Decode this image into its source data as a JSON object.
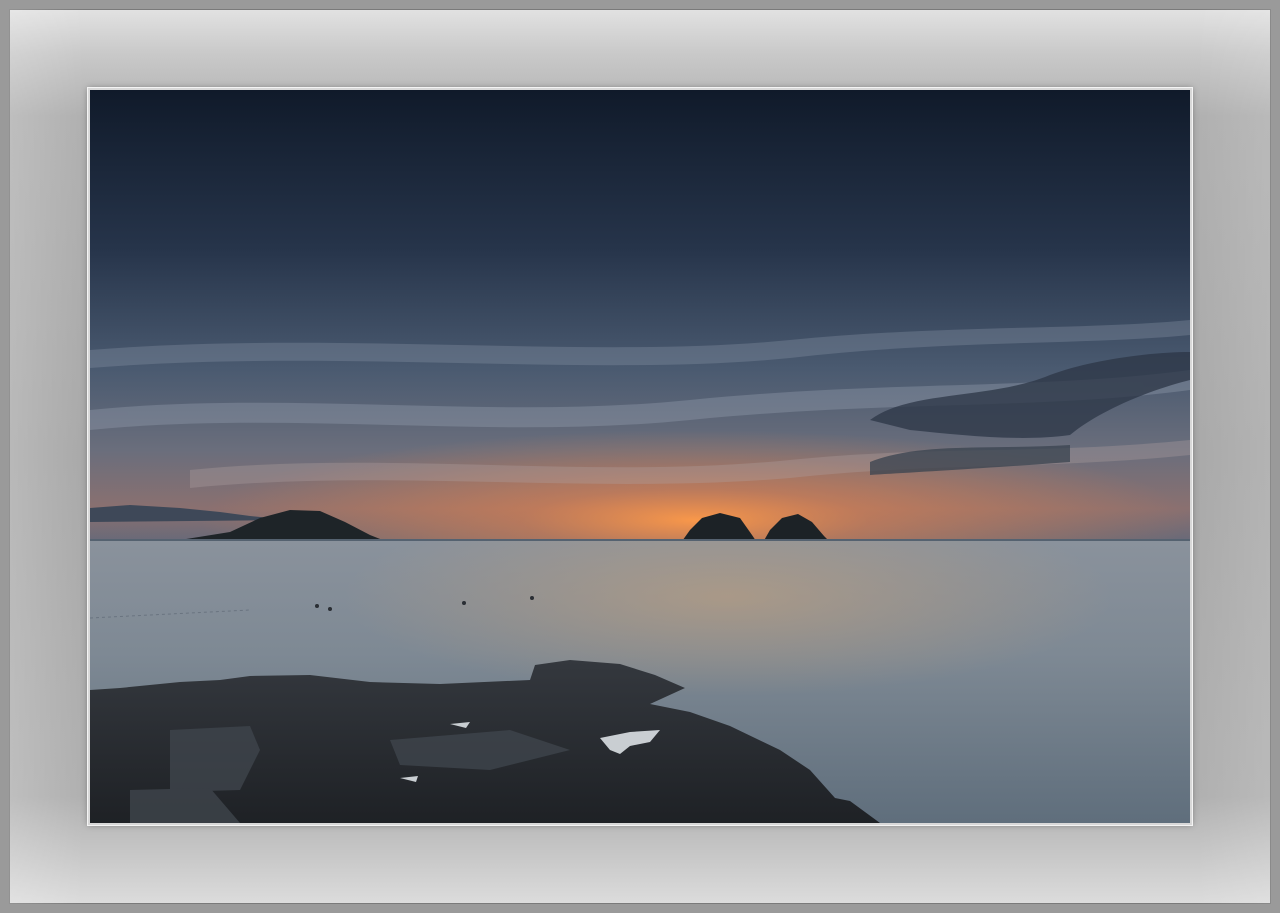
{
  "scene": {
    "subject": "seascape-sunset",
    "colors": {
      "sky_top": "#121b2b",
      "sky_mid": "#3a4a60",
      "horizon_glow": "#f08a3c",
      "sea": "#7d8a96",
      "rock": "#2a2e33",
      "mat": "#b0b0b0"
    }
  }
}
